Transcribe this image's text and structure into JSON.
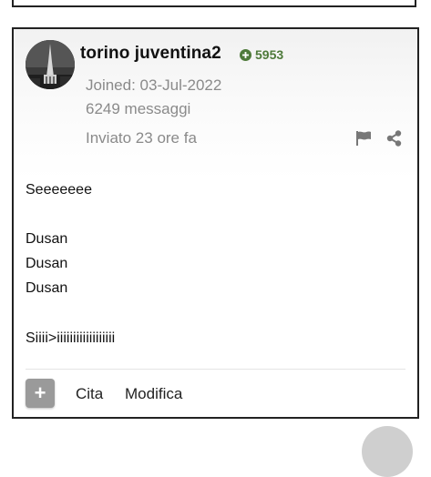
{
  "post": {
    "author": {
      "name": "torino juventina2",
      "reputation": "5953",
      "joined": "Joined: 03-Jul-2022",
      "message_count": "6249 messaggi"
    },
    "posted_time": "Inviato 23 ore fa",
    "body": [
      "Seeeeeee",
      "Dusan",
      "Dusan",
      "Dusan",
      "Siiii>iiiiiiiiiiiiiiiiii"
    ],
    "actions": {
      "quote": "Cita",
      "edit": "Modifica"
    }
  },
  "icons": [
    "plus-circle-icon",
    "flag-icon",
    "share-icon",
    "plus-icon"
  ],
  "colors": {
    "reputation": "#4e7a3a",
    "meta_text": "#8a8a8a",
    "border": "#222222"
  }
}
